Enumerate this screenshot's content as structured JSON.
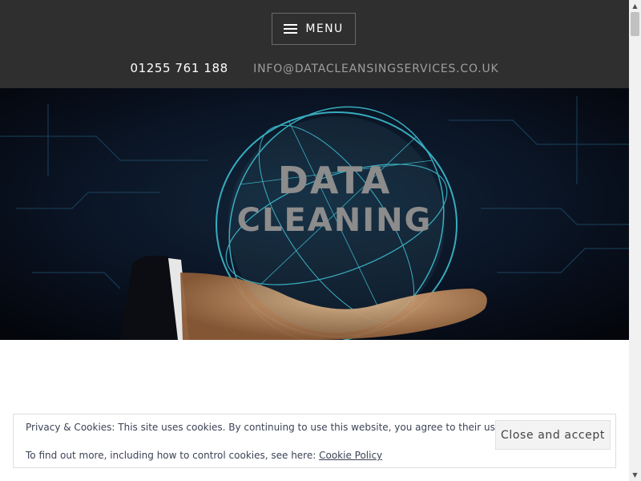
{
  "header": {
    "menu_label": "MENU",
    "phone": "01255 761 188",
    "email": "INFO@DATACLEANSINGSERVICES.CO.UK"
  },
  "hero": {
    "line1": "DATA",
    "line2": "CLEANING"
  },
  "cookie_banner": {
    "text": "Privacy & Cookies: This site uses cookies. By continuing to use this website, you agree to their use.",
    "find_out_prefix": "To find out more, including how to control cookies, see here: ",
    "policy_link": "Cookie Policy",
    "accept_button": "Close and accept"
  },
  "colors": {
    "header_bg": "#2f2f2f",
    "hero_glow": "#3fc6d8",
    "banner_text": "#3d4356"
  },
  "icons": {
    "menu": "hamburger-icon",
    "scroll_up": "scroll-up-arrow-icon",
    "scroll_down": "scroll-down-arrow-icon"
  }
}
